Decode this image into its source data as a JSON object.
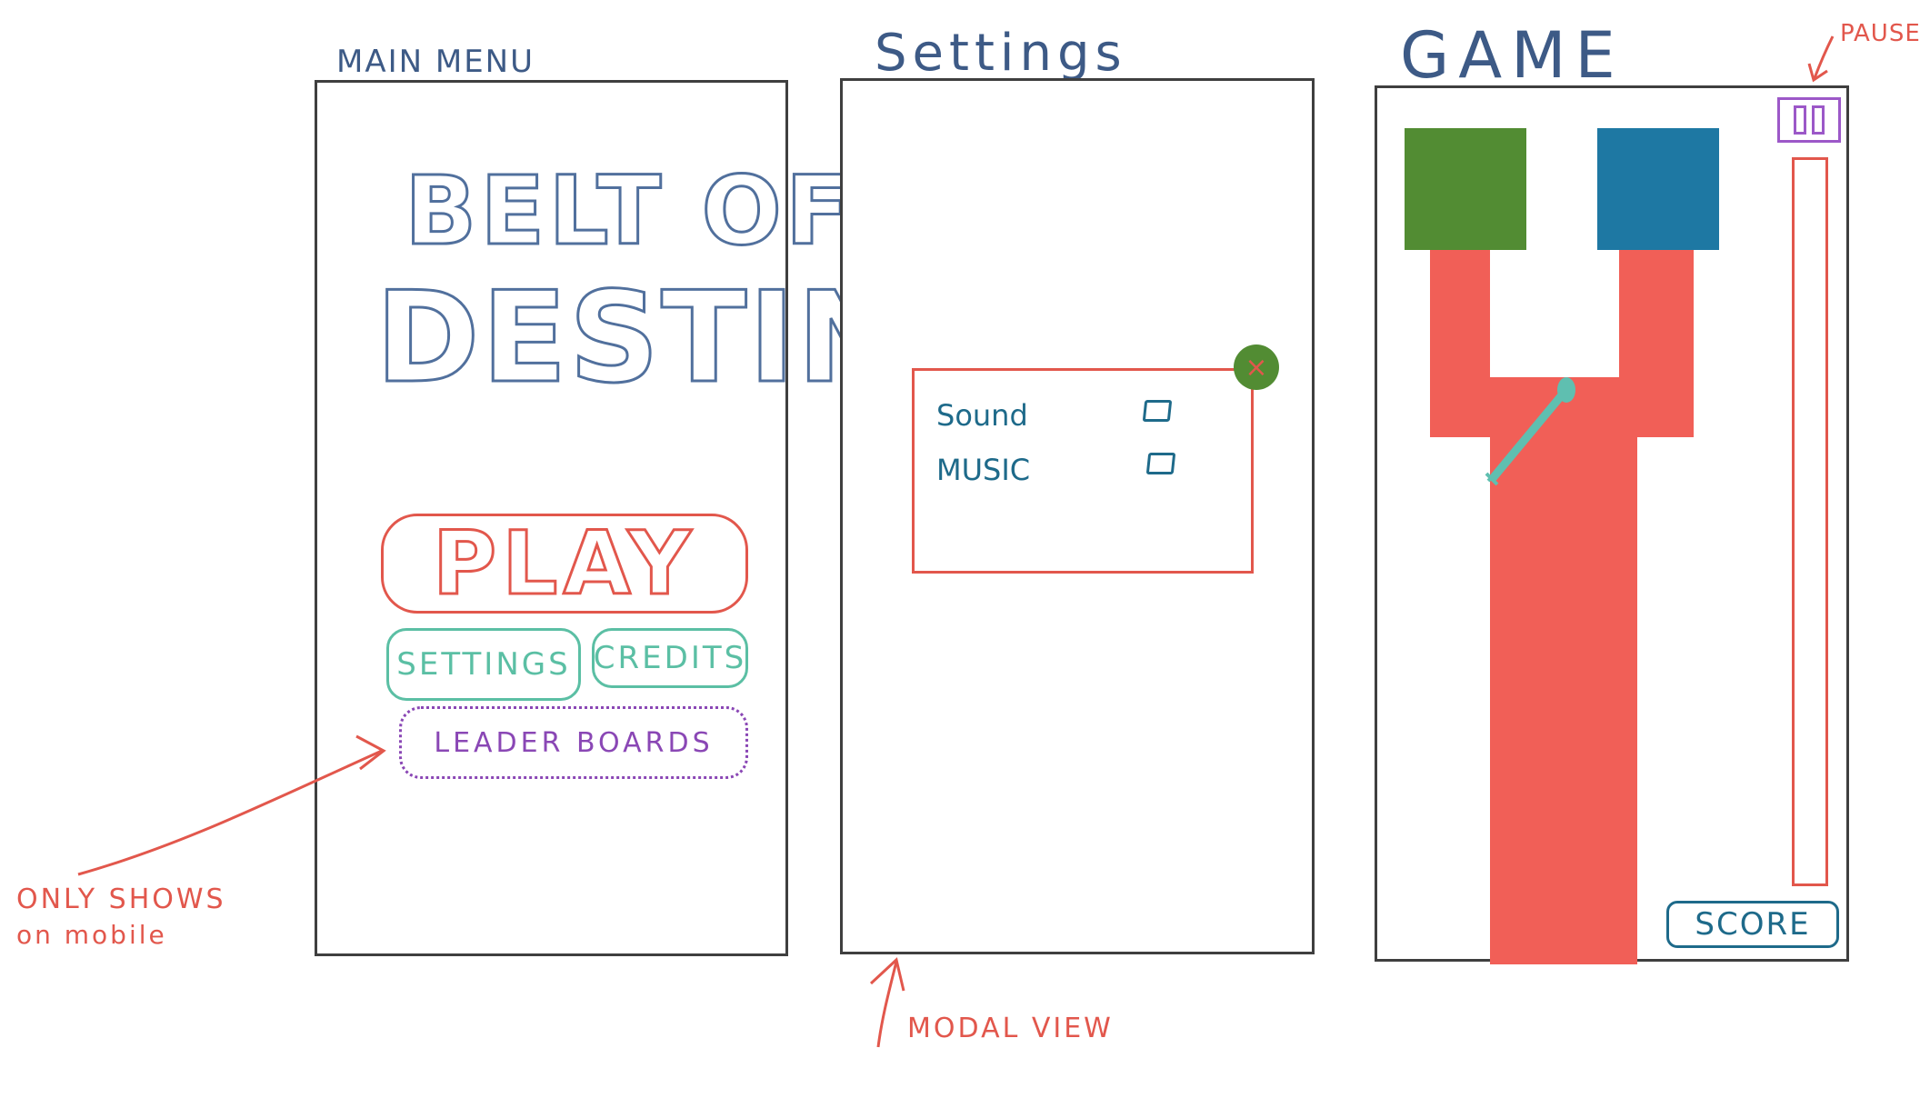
{
  "main_menu": {
    "heading": "MAIN MENU",
    "title_line1": "BELT OF",
    "title_line2": "DESTINY",
    "play_label": "PLAY",
    "settings_label": "SETTINGS",
    "credits_label": "CREDITS",
    "leaderboards_label": "LEADER BOARDS"
  },
  "settings": {
    "heading": "Settings",
    "close_icon": "×",
    "options": [
      {
        "label": "Sound"
      },
      {
        "label": "MUSIC"
      }
    ]
  },
  "game": {
    "heading": "GAME",
    "score_label": "SCORE"
  },
  "annotations": {
    "mobile_note_line1": "ONLY SHOWS",
    "mobile_note_line2": "on mobile",
    "modal_note": "MODAL VIEW",
    "pause_note": "PAUSE"
  },
  "colors": {
    "frame": "#3f3f3f",
    "title_blue": "#51709d",
    "accent_red": "#e2574c",
    "teal": "#5bbfa4",
    "purple": "#8a47b5",
    "green_block": "#528c33",
    "blue_block": "#1e78a3",
    "red_belt": "#f15f57"
  }
}
